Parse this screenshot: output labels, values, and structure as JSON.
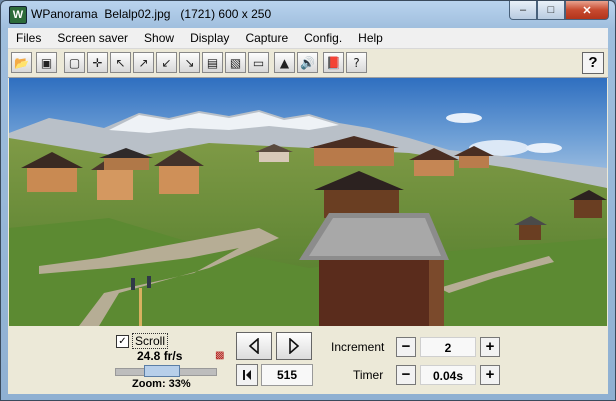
{
  "window": {
    "title": "WPanorama  Belalp02.jpg   (1721) 600 x 250",
    "app_icon_letter": "W",
    "caption_buttons": {
      "minimize": "–",
      "maximize": "□",
      "close": "✕"
    }
  },
  "menu": [
    "Files",
    "Screen saver",
    "Show",
    "Display",
    "Capture",
    "Config.",
    "Help"
  ],
  "toolbar": {
    "icons": [
      {
        "name": "open-file-icon",
        "glyph": "📂"
      },
      {
        "name": "picture-icon",
        "glyph": "▣"
      },
      {
        "name": "fit-window-icon",
        "glyph": "▢"
      },
      {
        "name": "move-all-directions-icon",
        "glyph": "✛"
      },
      {
        "name": "arrow-upleft-icon",
        "glyph": "↖"
      },
      {
        "name": "arrow-diagonal-out-icon",
        "glyph": "↗"
      },
      {
        "name": "arrow-diagonal-in-icon",
        "glyph": "↙"
      },
      {
        "name": "arrow-downright-icon",
        "glyph": "↘"
      },
      {
        "name": "panorama-view-icon",
        "glyph": "▤"
      },
      {
        "name": "landscape-view-icon",
        "glyph": "▧"
      },
      {
        "name": "wide-view-icon",
        "glyph": "▭"
      },
      {
        "name": "horizon-icon",
        "glyph": "▲"
      },
      {
        "name": "sound-icon",
        "glyph": "🔊"
      },
      {
        "name": "book-icon",
        "glyph": "📕"
      },
      {
        "name": "help-document-icon",
        "glyph": "?"
      }
    ],
    "help_button": "?"
  },
  "controls": {
    "scroll_label": "Scroll",
    "scroll_checked": true,
    "check_mark": "✓",
    "fps": "24.8 fr/s",
    "zoom": "Zoom: 33%",
    "zoom_slider_fraction": 0.33,
    "position": "515",
    "increment_label": "Increment",
    "increment_value": "2",
    "timer_label": "Timer",
    "timer_value": "0.04s",
    "minus": "−",
    "plus": "+"
  },
  "colors": {
    "sky": "#5f8fc8",
    "grass": "#5f8a2e",
    "panel": "#ece9d8"
  }
}
